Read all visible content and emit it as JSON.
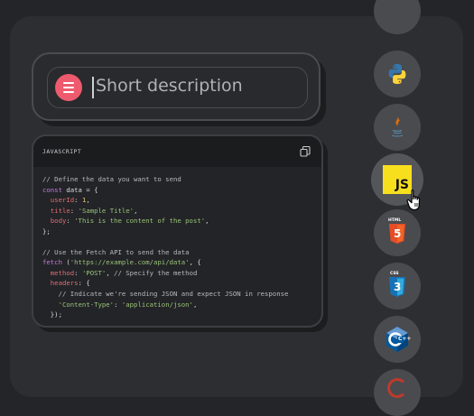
{
  "search": {
    "placeholder": "Short description",
    "menu_icon": "hamburger-menu-icon"
  },
  "code_block": {
    "language": "JAVASCRIPT",
    "copy_icon": "copy-icon",
    "lines": [
      [
        {
          "t": "// Define the data you want to send",
          "c": "comment"
        }
      ],
      [
        {
          "t": "const ",
          "c": "kw"
        },
        {
          "t": "data = {",
          "c": "plain"
        }
      ],
      [
        {
          "t": "  userId",
          "c": "prop"
        },
        {
          "t": ": ",
          "c": "plain"
        },
        {
          "t": "1",
          "c": "num"
        },
        {
          "t": ",",
          "c": "plain"
        }
      ],
      [
        {
          "t": "  title",
          "c": "prop"
        },
        {
          "t": ": ",
          "c": "plain"
        },
        {
          "t": "'Sample Title'",
          "c": "str"
        },
        {
          "t": ",",
          "c": "plain"
        }
      ],
      [
        {
          "t": "  body",
          "c": "prop"
        },
        {
          "t": ": ",
          "c": "plain"
        },
        {
          "t": "'This is the content of the post'",
          "c": "str"
        },
        {
          "t": ",",
          "c": "plain"
        }
      ],
      [
        {
          "t": "};",
          "c": "plain"
        }
      ],
      [
        {
          "t": "",
          "c": "plain"
        }
      ],
      [
        {
          "t": "// Use the Fetch API to send the data",
          "c": "comment"
        }
      ],
      [
        {
          "t": "fetch ",
          "c": "kw"
        },
        {
          "t": "(",
          "c": "plain"
        },
        {
          "t": "'https://example.com/api/data'",
          "c": "str"
        },
        {
          "t": ", {",
          "c": "plain"
        }
      ],
      [
        {
          "t": "  method",
          "c": "prop"
        },
        {
          "t": ": ",
          "c": "plain"
        },
        {
          "t": "'POST'",
          "c": "str"
        },
        {
          "t": ", ",
          "c": "plain"
        },
        {
          "t": "// Specify the method",
          "c": "comment"
        }
      ],
      [
        {
          "t": "  headers",
          "c": "prop"
        },
        {
          "t": ": {",
          "c": "plain"
        }
      ],
      [
        {
          "t": "    // Indicate we're sending JSON and expect JSON in response",
          "c": "comment"
        }
      ],
      [
        {
          "t": "    'Content-Type'",
          "c": "str"
        },
        {
          "t": ": ",
          "c": "plain"
        },
        {
          "t": "'application/json'",
          "c": "str"
        },
        {
          "t": ",",
          "c": "plain"
        }
      ],
      [
        {
          "t": "  });",
          "c": "plain"
        }
      ]
    ]
  },
  "languages": [
    {
      "name": "unknown-partial-top",
      "icon": "language-icon"
    },
    {
      "name": "Python",
      "icon": "python-icon"
    },
    {
      "name": "Java",
      "icon": "java-icon"
    },
    {
      "name": "JavaScript",
      "icon": "javascript-icon",
      "label": "JS",
      "selected": true
    },
    {
      "name": "HTML5",
      "icon": "html5-icon",
      "label": "HTML",
      "badge": "5"
    },
    {
      "name": "CSS3",
      "icon": "css3-icon",
      "label": "CSS",
      "badge": "3"
    },
    {
      "name": "C++",
      "icon": "cpp-icon",
      "label": "C++"
    },
    {
      "name": "unknown-partial-bottom",
      "icon": "language-icon"
    }
  ],
  "colors": {
    "background": "#242528",
    "panel": "#2d2e31",
    "menu_button": "#ee5a6e",
    "js_yellow": "#f7df1e",
    "html_orange": "#e44d26",
    "css_blue": "#1572b6",
    "cpp_blue": "#00599c",
    "python_blue": "#3776ab",
    "python_yellow": "#ffd43b"
  }
}
